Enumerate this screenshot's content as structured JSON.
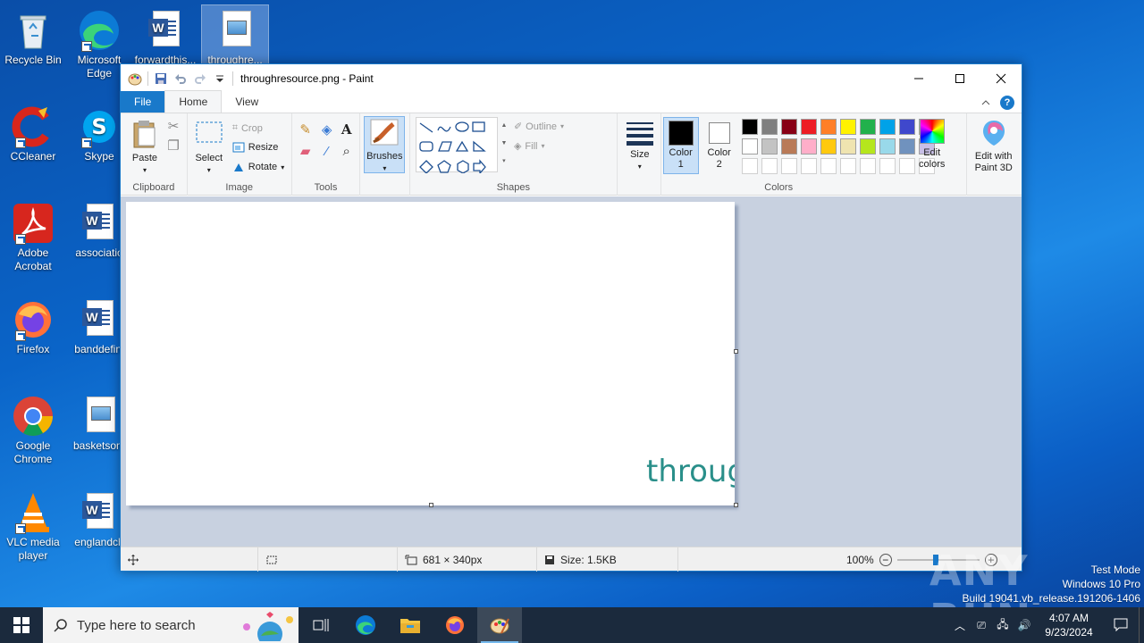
{
  "desktop": {
    "icons": [
      {
        "label": "Recycle Bin",
        "icon": "recycle-bin-icon"
      },
      {
        "label": "Microsoft Edge",
        "icon": "edge-icon"
      },
      {
        "label": "forwardthis...",
        "icon": "word-doc-icon"
      },
      {
        "label": "throughre...",
        "icon": "image-file-icon"
      },
      {
        "label": "CCleaner",
        "icon": "ccleaner-icon"
      },
      {
        "label": "Skype",
        "icon": "skype-icon"
      },
      {
        "label": "Adobe Acrobat",
        "icon": "acrobat-icon"
      },
      {
        "label": "associatio",
        "icon": "word-doc-icon"
      },
      {
        "label": "Firefox",
        "icon": "firefox-icon"
      },
      {
        "label": "banddefini",
        "icon": "word-doc-icon"
      },
      {
        "label": "Google Chrome",
        "icon": "chrome-icon"
      },
      {
        "label": "basketsom",
        "icon": "image-file-icon"
      },
      {
        "label": "VLC media player",
        "icon": "vlc-icon"
      },
      {
        "label": "englandch",
        "icon": "word-doc-icon"
      }
    ]
  },
  "paint": {
    "title": "throughresource.png - Paint",
    "tabs": {
      "file": "File",
      "home": "Home",
      "view": "View"
    },
    "clipboard": {
      "paste": "Paste",
      "label": "Clipboard"
    },
    "image": {
      "select": "Select",
      "crop": "Crop",
      "resize": "Resize",
      "rotate": "Rotate",
      "label": "Image"
    },
    "tools": {
      "label": "Tools"
    },
    "brushes": {
      "label": "Brushes"
    },
    "shapes": {
      "outline": "Outline",
      "fill": "Fill",
      "label": "Shapes"
    },
    "size": {
      "label": "Size"
    },
    "colors": {
      "color1": "Color 1",
      "color2": "Color 2",
      "edit_colors": "Edit colors",
      "edit_paint3d": "Edit with Paint 3D",
      "label": "Colors",
      "color1_value": "#000000",
      "color2_value": "#ffffff",
      "palette_row1": [
        "#000000",
        "#7f7f7f",
        "#880015",
        "#ed1c24",
        "#ff7f27",
        "#fff200",
        "#22b14c",
        "#00a2e8",
        "#3f48cc",
        "#a349a4"
      ],
      "palette_row2": [
        "#ffffff",
        "#c3c3c3",
        "#b97a57",
        "#ffaec9",
        "#ffc90e",
        "#efe4b0",
        "#b5e61d",
        "#99d9ea",
        "#7092be",
        "#c8bfe7"
      ],
      "palette_row3": [
        "#ffffff",
        "#ffffff",
        "#ffffff",
        "#ffffff",
        "#ffffff",
        "#ffffff",
        "#ffffff",
        "#ffffff",
        "#ffffff",
        "#ffffff"
      ]
    },
    "canvas": {
      "text": "throug",
      "text_color": "#2a8f8a"
    },
    "status": {
      "dimensions": "681 × 340px",
      "size": "Size: 1.5KB",
      "zoom": "100%"
    }
  },
  "watermark": {
    "brand": "ANY RUN",
    "line1": "Test Mode",
    "line2": "Windows 10 Pro",
    "line3": "Build 19041.vb_release.191206-1406"
  },
  "taskbar": {
    "search_placeholder": "Type here to search",
    "time": "4:07 AM",
    "date": "9/23/2024"
  }
}
